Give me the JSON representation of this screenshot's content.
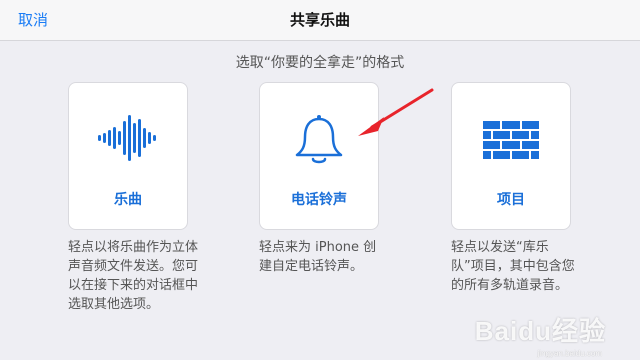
{
  "navbar": {
    "cancel_label": "取消",
    "title": "共享乐曲"
  },
  "subtitle": "选取“你要的全拿走”的格式",
  "options": [
    {
      "label": "乐曲",
      "icon": "waveform-icon",
      "description": "轻点以将乐曲作为立体声音频文件发送。您可以在接下来的对话框中选取其他选项。"
    },
    {
      "label": "电话铃声",
      "icon": "bell-icon",
      "description": "轻点来为 iPhone 创建自定电话铃声。"
    },
    {
      "label": "项目",
      "icon": "brick-wall-icon",
      "description": "轻点以发送“库乐队”项目，其中包含您的所有多轨道录音。"
    }
  ],
  "watermark": {
    "text": "Baidu经验",
    "subtext": "jingyan.baidu.com"
  },
  "colors": {
    "accent": "#1a6fd8",
    "annotation_arrow": "#e8242b",
    "background": "#eeeef3"
  }
}
